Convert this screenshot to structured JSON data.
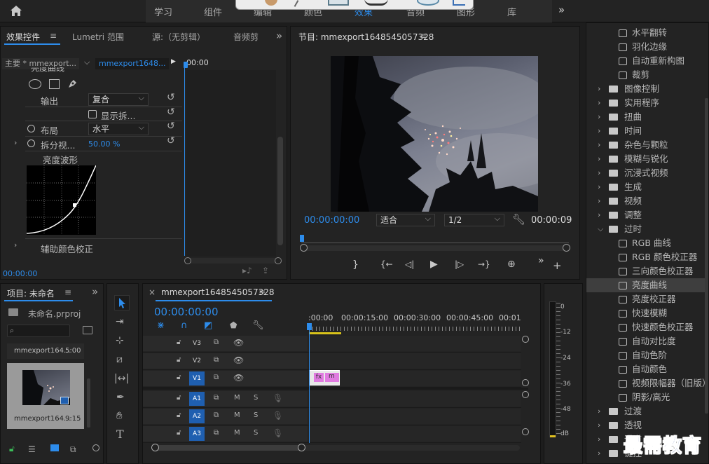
{
  "top_bar": {
    "workspaces": [
      "学习",
      "组件",
      "编辑",
      "颜色",
      "效果",
      "音频",
      "图形",
      "库"
    ],
    "more": "»"
  },
  "effect_controls": {
    "tabs": [
      "效果控件",
      "Lumetri 范围",
      "源:（无剪辑）",
      "音频剪"
    ],
    "menu_glyph": "≡",
    "more": "»",
    "clip_selector": "主要 * mmexport...",
    "clip_active": "mmexport1648...",
    "play_glyph": "▶",
    "timecode_mini": "00:00",
    "section_title": "亮度曲线",
    "rows": {
      "output_label": "输出",
      "output_value": "复合",
      "show_split": "显示拆...",
      "layout_label": "布局",
      "layout_value": "水平",
      "split_label": "拆分视...",
      "split_value": "50.00 %",
      "waveform_label": "亮度波形",
      "aux_label": "辅助颜色校正"
    },
    "timecode": "00:00:00"
  },
  "program_monitor": {
    "title": "节目: mmexport1648545057328",
    "menu_glyph": "≡",
    "timecode_left": "00:00:00:00",
    "fit": "适合",
    "quality": "1/2",
    "timecode_right": "00:00:09",
    "buttons": [
      "}",
      "{←",
      "◁|",
      "▶",
      "|▷",
      "→}",
      "⊕"
    ],
    "more": "»",
    "add": "+"
  },
  "effects_panel": {
    "items": [
      {
        "type": "fx",
        "label": "垂直翻转"
      },
      {
        "type": "fx",
        "label": "水平翻转"
      },
      {
        "type": "fx",
        "label": "羽化边缘"
      },
      {
        "type": "fx",
        "label": "自动重新构图"
      },
      {
        "type": "fx",
        "label": "裁剪"
      },
      {
        "type": "folder",
        "label": "图像控制"
      },
      {
        "type": "folder",
        "label": "实用程序"
      },
      {
        "type": "folder",
        "label": "扭曲"
      },
      {
        "type": "folder",
        "label": "时间"
      },
      {
        "type": "folder",
        "label": "杂色与颗粒"
      },
      {
        "type": "folder",
        "label": "模糊与锐化"
      },
      {
        "type": "folder",
        "label": "沉浸式视频"
      },
      {
        "type": "folder",
        "label": "生成"
      },
      {
        "type": "folder",
        "label": "视频"
      },
      {
        "type": "folder",
        "label": "调整"
      },
      {
        "type": "folder_open",
        "label": "过时"
      },
      {
        "type": "fx",
        "label": "RGB 曲线"
      },
      {
        "type": "fx",
        "label": "RGB 颜色校正器"
      },
      {
        "type": "fx",
        "label": "三向颜色校正器"
      },
      {
        "type": "fx",
        "label": "亮度曲线",
        "selected": true
      },
      {
        "type": "fx",
        "label": "亮度校正器"
      },
      {
        "type": "fx",
        "label": "快速模糊"
      },
      {
        "type": "fx",
        "label": "快速颜色校正器"
      },
      {
        "type": "fx",
        "label": "自动对比度"
      },
      {
        "type": "fx",
        "label": "自动色阶"
      },
      {
        "type": "fx",
        "label": "自动颜色"
      },
      {
        "type": "fx",
        "label": "视频限幅器（旧版）"
      },
      {
        "type": "fx",
        "label": "阴影/高光"
      },
      {
        "type": "folder",
        "label": "过渡"
      },
      {
        "type": "folder",
        "label": "透视"
      },
      {
        "type": "folder",
        "label": "通道"
      },
      {
        "type": "folder",
        "label": "键控"
      }
    ],
    "watermark": "最需教育"
  },
  "project": {
    "title": "项目: 未命名",
    "menu_glyph": "≡",
    "more": "»",
    "file": "未命名.prproj",
    "search_placeholder": "",
    "clip1_name": "mmexport164...",
    "clip1_dur": "5:00",
    "clip2_name": "mmexport164...",
    "clip2_dur": "9:15"
  },
  "timeline": {
    "close": "×",
    "title": "mmexport1648545057328",
    "menu_glyph": "≡",
    "timecode": "00:00:00:00",
    "ruler": [
      ":00:00",
      "00:00:15:00",
      "00:00:30:00",
      "00:00:45:00",
      "00:01:0"
    ],
    "video_tracks": [
      "V3",
      "V2",
      "V1"
    ],
    "audio_tracks": [
      "A1",
      "A2",
      "A3"
    ],
    "m": "M",
    "s": "S",
    "clip_fx": "fx",
    "clip_m": "m"
  },
  "meter": {
    "labels": [
      "0",
      "-12",
      "-24",
      "-36",
      "-48",
      "dB"
    ]
  }
}
